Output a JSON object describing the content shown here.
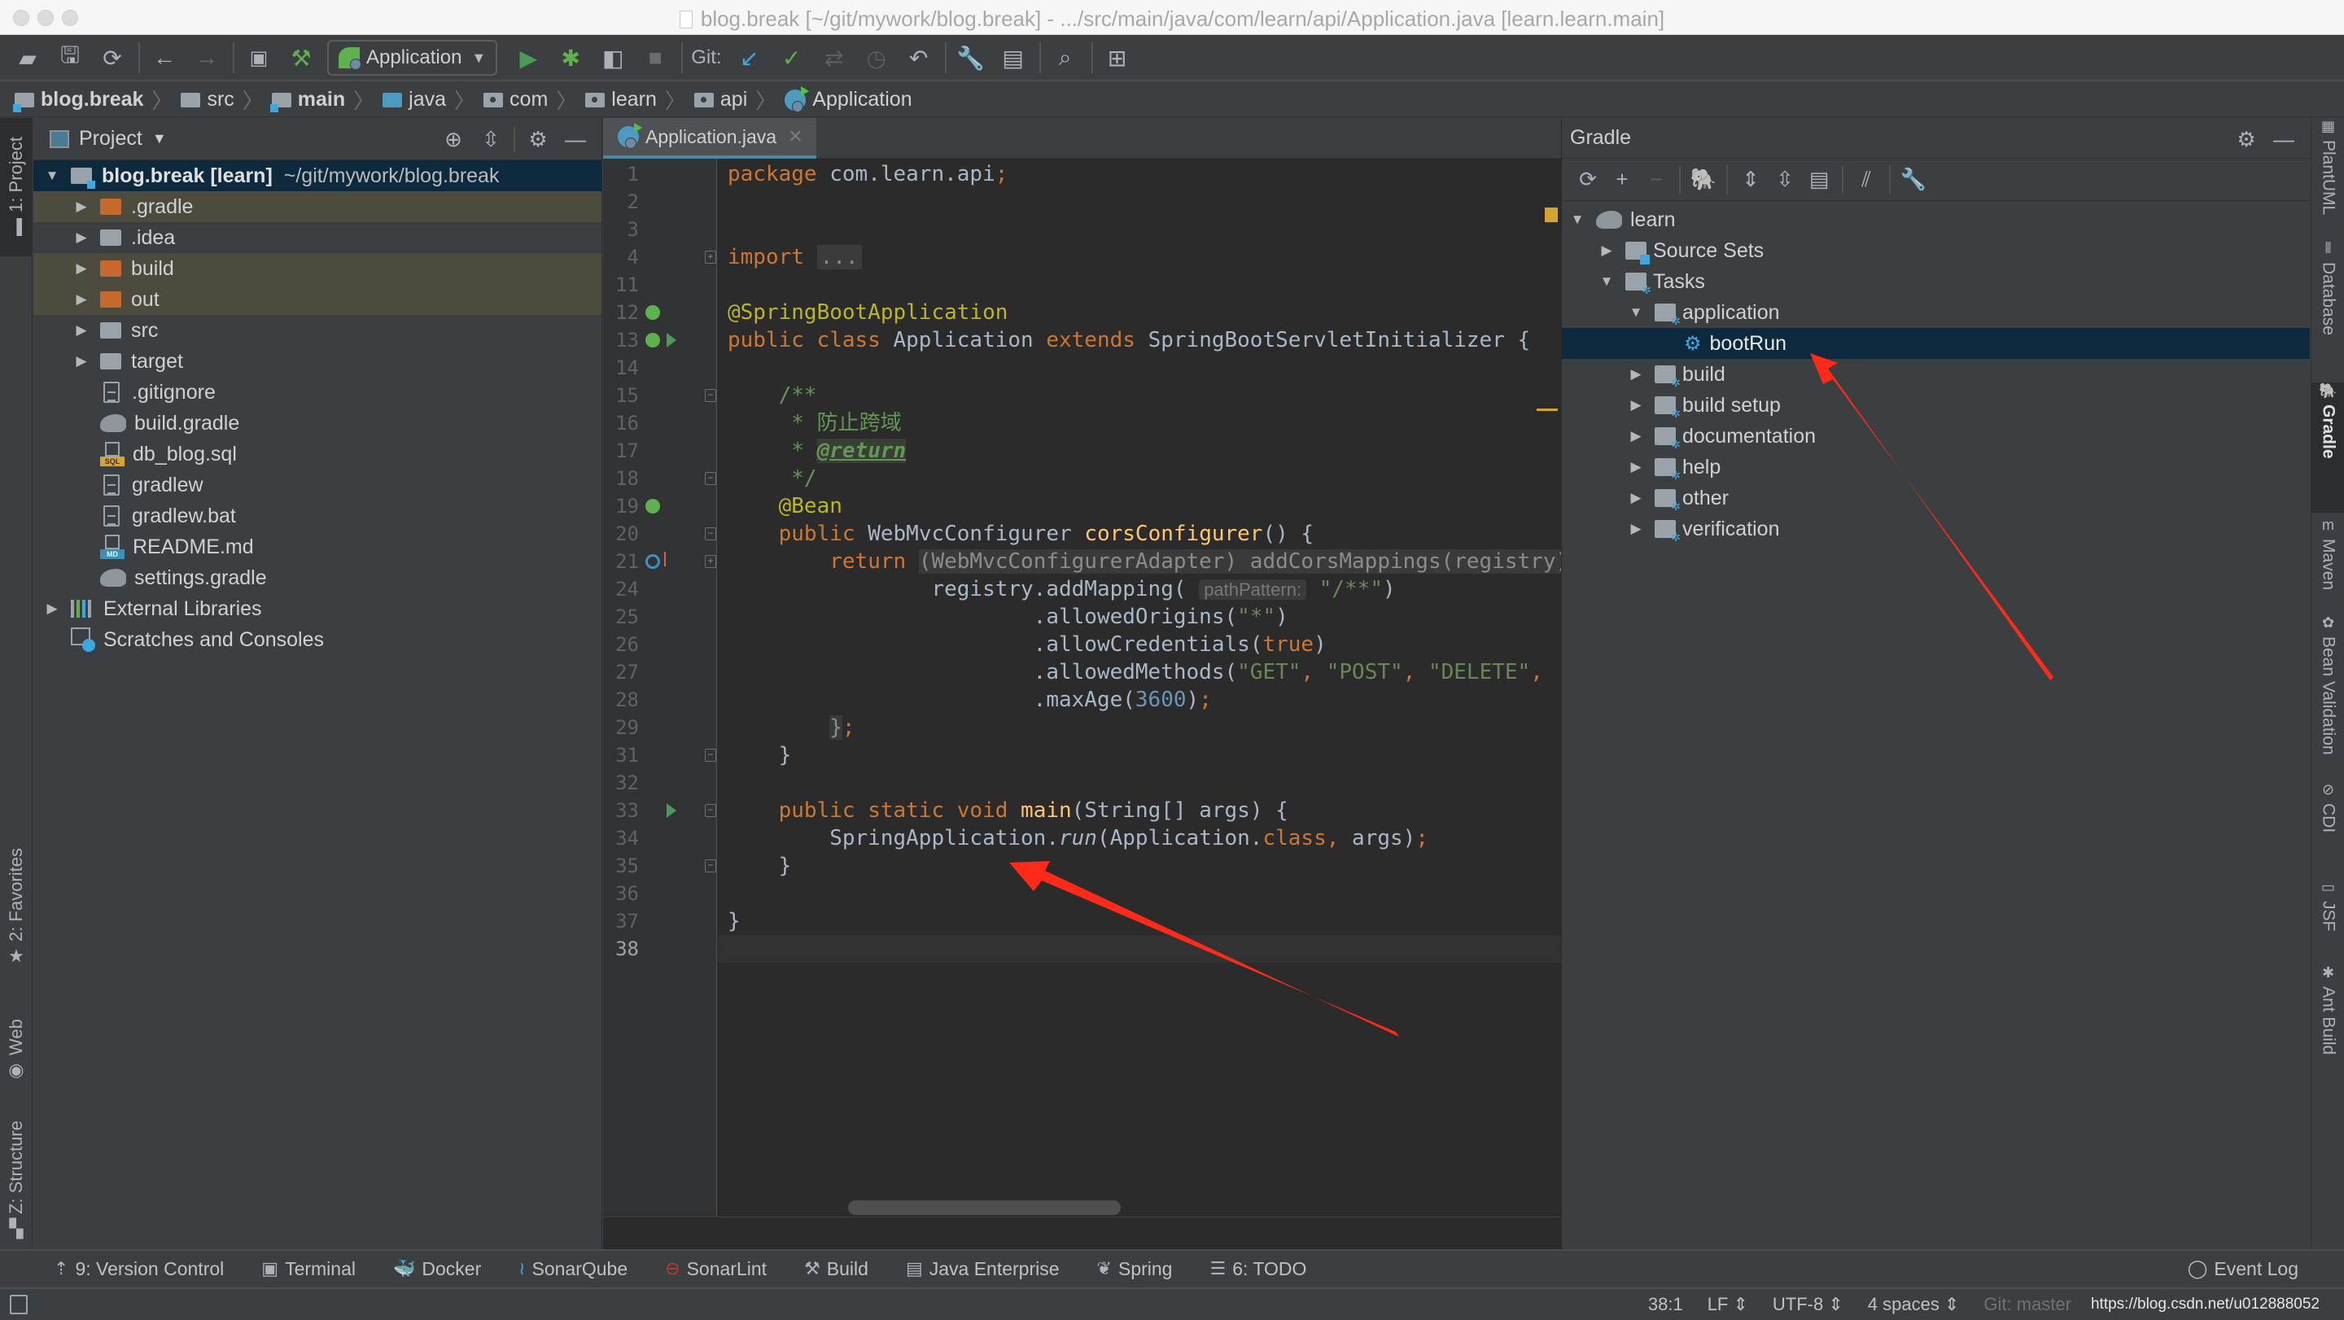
{
  "window": {
    "title": "blog.break [~/git/mywork/blog.break] - .../src/main/java/com/learn/api/Application.java [learn.learn.main]"
  },
  "toolbar": {
    "run_config": "Application",
    "git_label": "Git:",
    "icons": [
      "open-folder-icon",
      "save-icon",
      "sync-icon",
      "back-icon",
      "forward-icon",
      "run-window-icon",
      "build-hammer-icon",
      "run-icon",
      "debug-icon",
      "coverage-icon",
      "stop-icon",
      "git-update-icon",
      "git-commit-icon",
      "git-compare-icon",
      "git-history-icon",
      "git-rollback-icon",
      "settings-wrench-icon",
      "project-structure-icon",
      "search-icon",
      "sdk-manager-icon"
    ]
  },
  "breadcrumb": [
    {
      "label": "blog.break",
      "icon": "module-folder-icon",
      "bold": true
    },
    {
      "label": "src",
      "icon": "folder-icon",
      "bold": false
    },
    {
      "label": "main",
      "icon": "module-folder-icon",
      "bold": true
    },
    {
      "label": "java",
      "icon": "source-folder-icon",
      "bold": false
    },
    {
      "label": "com",
      "icon": "package-icon",
      "bold": false
    },
    {
      "label": "learn",
      "icon": "package-icon",
      "bold": false
    },
    {
      "label": "api",
      "icon": "package-icon",
      "bold": false
    },
    {
      "label": "Application",
      "icon": "spring-class-icon",
      "bold": false
    }
  ],
  "left_strip": {
    "project_tab": "1: Project",
    "favorites_tab": "2: Favorites",
    "web_tab": "Web",
    "structure_tab": "Z: Structure"
  },
  "project_panel": {
    "title": "Project",
    "root": {
      "name": "blog.break [learn]",
      "path": "~/git/mywork/blog.break"
    },
    "items": [
      {
        "name": ".gradle",
        "type": "excluded-folder",
        "expandable": true
      },
      {
        "name": ".idea",
        "type": "folder",
        "expandable": true
      },
      {
        "name": "build",
        "type": "excluded-folder",
        "expandable": true
      },
      {
        "name": "out",
        "type": "excluded-folder",
        "expandable": true
      },
      {
        "name": "src",
        "type": "folder",
        "expandable": true
      },
      {
        "name": "target",
        "type": "folder",
        "expandable": true
      },
      {
        "name": ".gitignore",
        "type": "text-file"
      },
      {
        "name": "build.gradle",
        "type": "gradle-file"
      },
      {
        "name": "db_blog.sql",
        "type": "sql-file",
        "badge": "SQL"
      },
      {
        "name": "gradlew",
        "type": "text-file"
      },
      {
        "name": "gradlew.bat",
        "type": "text-file"
      },
      {
        "name": "README.md",
        "type": "md-file",
        "badge": "MD"
      },
      {
        "name": "settings.gradle",
        "type": "gradle-file"
      }
    ],
    "external_libraries": "External Libraries",
    "scratches": "Scratches and Consoles"
  },
  "editor": {
    "tab": "Application.java",
    "current_line": 38,
    "lines": [
      {
        "n": "1",
        "html": "<span class=\"kw\">package</span> com.learn.api<span class=\"kw\">;</span>"
      },
      {
        "n": "2",
        "html": ""
      },
      {
        "n": "3",
        "html": ""
      },
      {
        "n": "4",
        "html": "<span class=\"kw\">import</span> <span class=\"fold-box\">...</span>"
      },
      {
        "n": "11",
        "html": ""
      },
      {
        "n": "12",
        "html": "<span class=\"ann\">@SpringBootApplication</span>"
      },
      {
        "n": "13",
        "html": "<span class=\"kw\">public class</span> Application <span class=\"kw\">extends</span> SpringBootServletInitializer {"
      },
      {
        "n": "14",
        "html": ""
      },
      {
        "n": "15",
        "html": "    <span class=\"doc\">/**</span>"
      },
      {
        "n": "16",
        "html": "    <span class=\"doc\"> * 防止跨域</span>"
      },
      {
        "n": "17",
        "html": "    <span class=\"doc\"> * </span><span class=\"doctag\">@return</span>"
      },
      {
        "n": "18",
        "html": "    <span class=\"doc\"> */</span>"
      },
      {
        "n": "19",
        "html": "    <span class=\"ann\">@Bean</span>"
      },
      {
        "n": "20",
        "html": "    <span class=\"kw\">public</span> WebMvcConfigurer <span class=\"fn\">corsConfigurer</span>() {"
      },
      {
        "n": "21",
        "html": "        <span class=\"kw\">return</span> <span class=\"collapsed\">(WebMvcConfigurerAdapter) addCorsMappings(registry) {</span>"
      },
      {
        "n": "24",
        "html": "                registry.addMapping( <span class=\"hint\">pathPattern:</span> <span class=\"str\">\"/**\"</span>)"
      },
      {
        "n": "25",
        "html": "                        .allowedOrigins(<span class=\"str\">\"*\"</span>)"
      },
      {
        "n": "26",
        "html": "                        .allowCredentials(<span class=\"kw\">true</span>)"
      },
      {
        "n": "27",
        "html": "                        .allowedMethods(<span class=\"str\">\"GET\"</span><span class=\"kw\">, </span><span class=\"str\">\"POST\"</span><span class=\"kw\">, </span><span class=\"str\">\"DELETE\"</span><span class=\"kw\">,</span>"
      },
      {
        "n": "28",
        "html": "                        .maxAge(<span class=\"num\">3600</span>)<span class=\"kw\">;</span>"
      },
      {
        "n": "29",
        "html": "        <span class=\"collapsed\">}</span><span class=\"kw\">;</span>"
      },
      {
        "n": "31",
        "html": "    }"
      },
      {
        "n": "32",
        "html": ""
      },
      {
        "n": "33",
        "html": "    <span class=\"kw\">public static void</span> <span class=\"fn\">main</span>(String[] args) {"
      },
      {
        "n": "34",
        "html": "        SpringApplication.<span class=\"italic\">run</span>(Application.<span class=\"kw\">class, </span>args)<span class=\"kw\">;</span>"
      },
      {
        "n": "35",
        "html": "    }"
      },
      {
        "n": "36",
        "html": ""
      },
      {
        "n": "37",
        "html": "}"
      },
      {
        "n": "38",
        "html": ""
      }
    ]
  },
  "gradle_panel": {
    "title": "Gradle",
    "tree": [
      {
        "label": "learn",
        "level": 0,
        "state": "expanded",
        "icon": "gradle-elephant-icon"
      },
      {
        "label": "Source Sets",
        "level": 1,
        "state": "collapsed",
        "icon": "source-sets-icon"
      },
      {
        "label": "Tasks",
        "level": 1,
        "state": "expanded",
        "icon": "task-folder-icon"
      },
      {
        "label": "application",
        "level": 2,
        "state": "expanded",
        "icon": "task-folder-icon"
      },
      {
        "label": "bootRun",
        "level": 3,
        "state": "leaf",
        "icon": "gear-icon",
        "selected": true
      },
      {
        "label": "build",
        "level": 2,
        "state": "collapsed",
        "icon": "task-folder-icon"
      },
      {
        "label": "build setup",
        "level": 2,
        "state": "collapsed",
        "icon": "task-folder-icon"
      },
      {
        "label": "documentation",
        "level": 2,
        "state": "collapsed",
        "icon": "task-folder-icon"
      },
      {
        "label": "help",
        "level": 2,
        "state": "collapsed",
        "icon": "task-folder-icon"
      },
      {
        "label": "other",
        "level": 2,
        "state": "collapsed",
        "icon": "task-folder-icon"
      },
      {
        "label": "verification",
        "level": 2,
        "state": "collapsed",
        "icon": "task-folder-icon"
      }
    ]
  },
  "right_strip": [
    "PlantUML",
    "Database",
    "Gradle",
    "Maven",
    "Bean Validation",
    "CDI",
    "JSF",
    "Ant Build"
  ],
  "bottom_tools": [
    {
      "label": "9: Version Control",
      "icon": "version-control-icon"
    },
    {
      "label": "Terminal",
      "icon": "terminal-icon"
    },
    {
      "label": "Docker",
      "icon": "docker-icon"
    },
    {
      "label": "SonarQube",
      "icon": "sonarqube-icon"
    },
    {
      "label": "SonarLint",
      "icon": "sonarlint-icon"
    },
    {
      "label": "Build",
      "icon": "build-hammer-icon"
    },
    {
      "label": "Java Enterprise",
      "icon": "java-enterprise-icon"
    },
    {
      "label": "Spring",
      "icon": "spring-leaf-icon"
    },
    {
      "label": "6: TODO",
      "icon": "todo-list-icon"
    }
  ],
  "event_log": "Event Log",
  "status": {
    "position": "38:1",
    "line_sep": "LF",
    "encoding": "UTF-8",
    "indent": "4 spaces",
    "git": "Git: master",
    "watermark": "https://blog.csdn.net/u012888052"
  },
  "colors": {
    "selection": "#0d293e",
    "annotation_arrow": "#ff2a1a",
    "keyword": "#cc7832",
    "string": "#6a8759",
    "annotation": "#bbb529"
  }
}
